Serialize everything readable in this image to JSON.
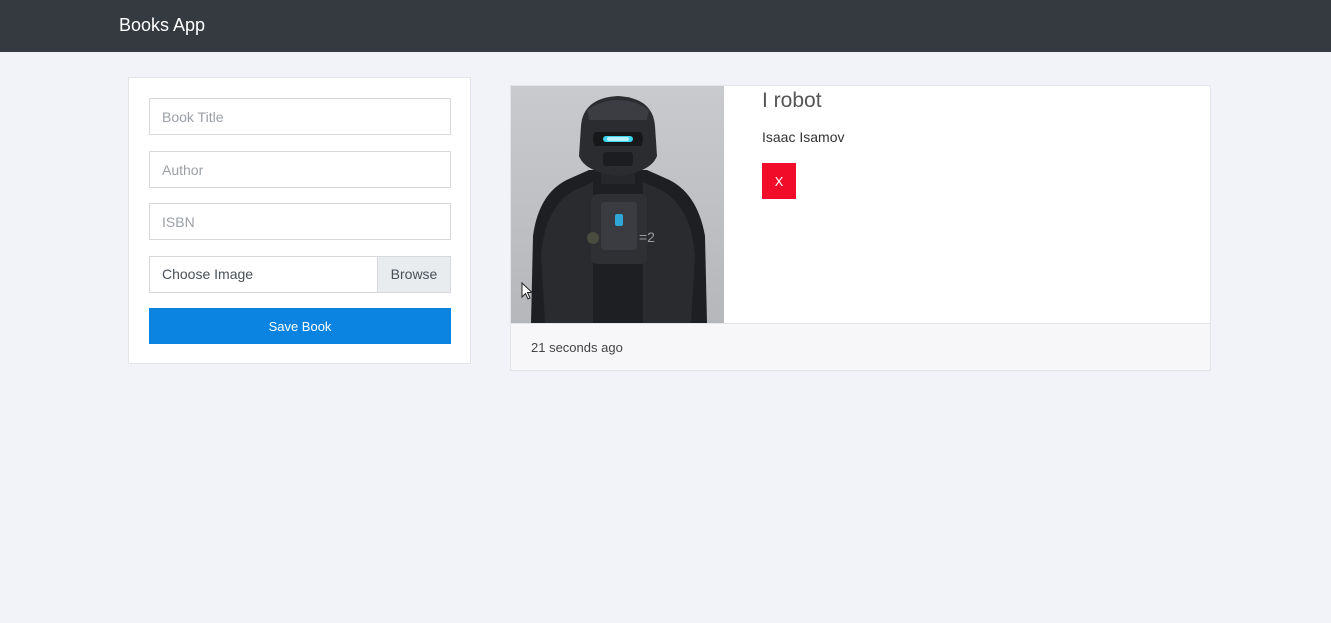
{
  "navbar": {
    "brand": "Books App"
  },
  "form": {
    "title_placeholder": "Book Title",
    "author_placeholder": "Author",
    "isbn_placeholder": "ISBN",
    "image_label": "Choose Image",
    "browse_label": "Browse",
    "save_label": "Save Book"
  },
  "books": [
    {
      "title": "I robot",
      "author": "Isaac Isamov",
      "delete_label": "X",
      "added": "21 seconds ago"
    }
  ],
  "colors": {
    "navbar_bg": "#343a40",
    "page_bg": "#f2f3f8",
    "primary": "#0a84e0",
    "danger": "#f10d2a"
  },
  "icons": {
    "cursor": "mouse-pointer-icon"
  }
}
